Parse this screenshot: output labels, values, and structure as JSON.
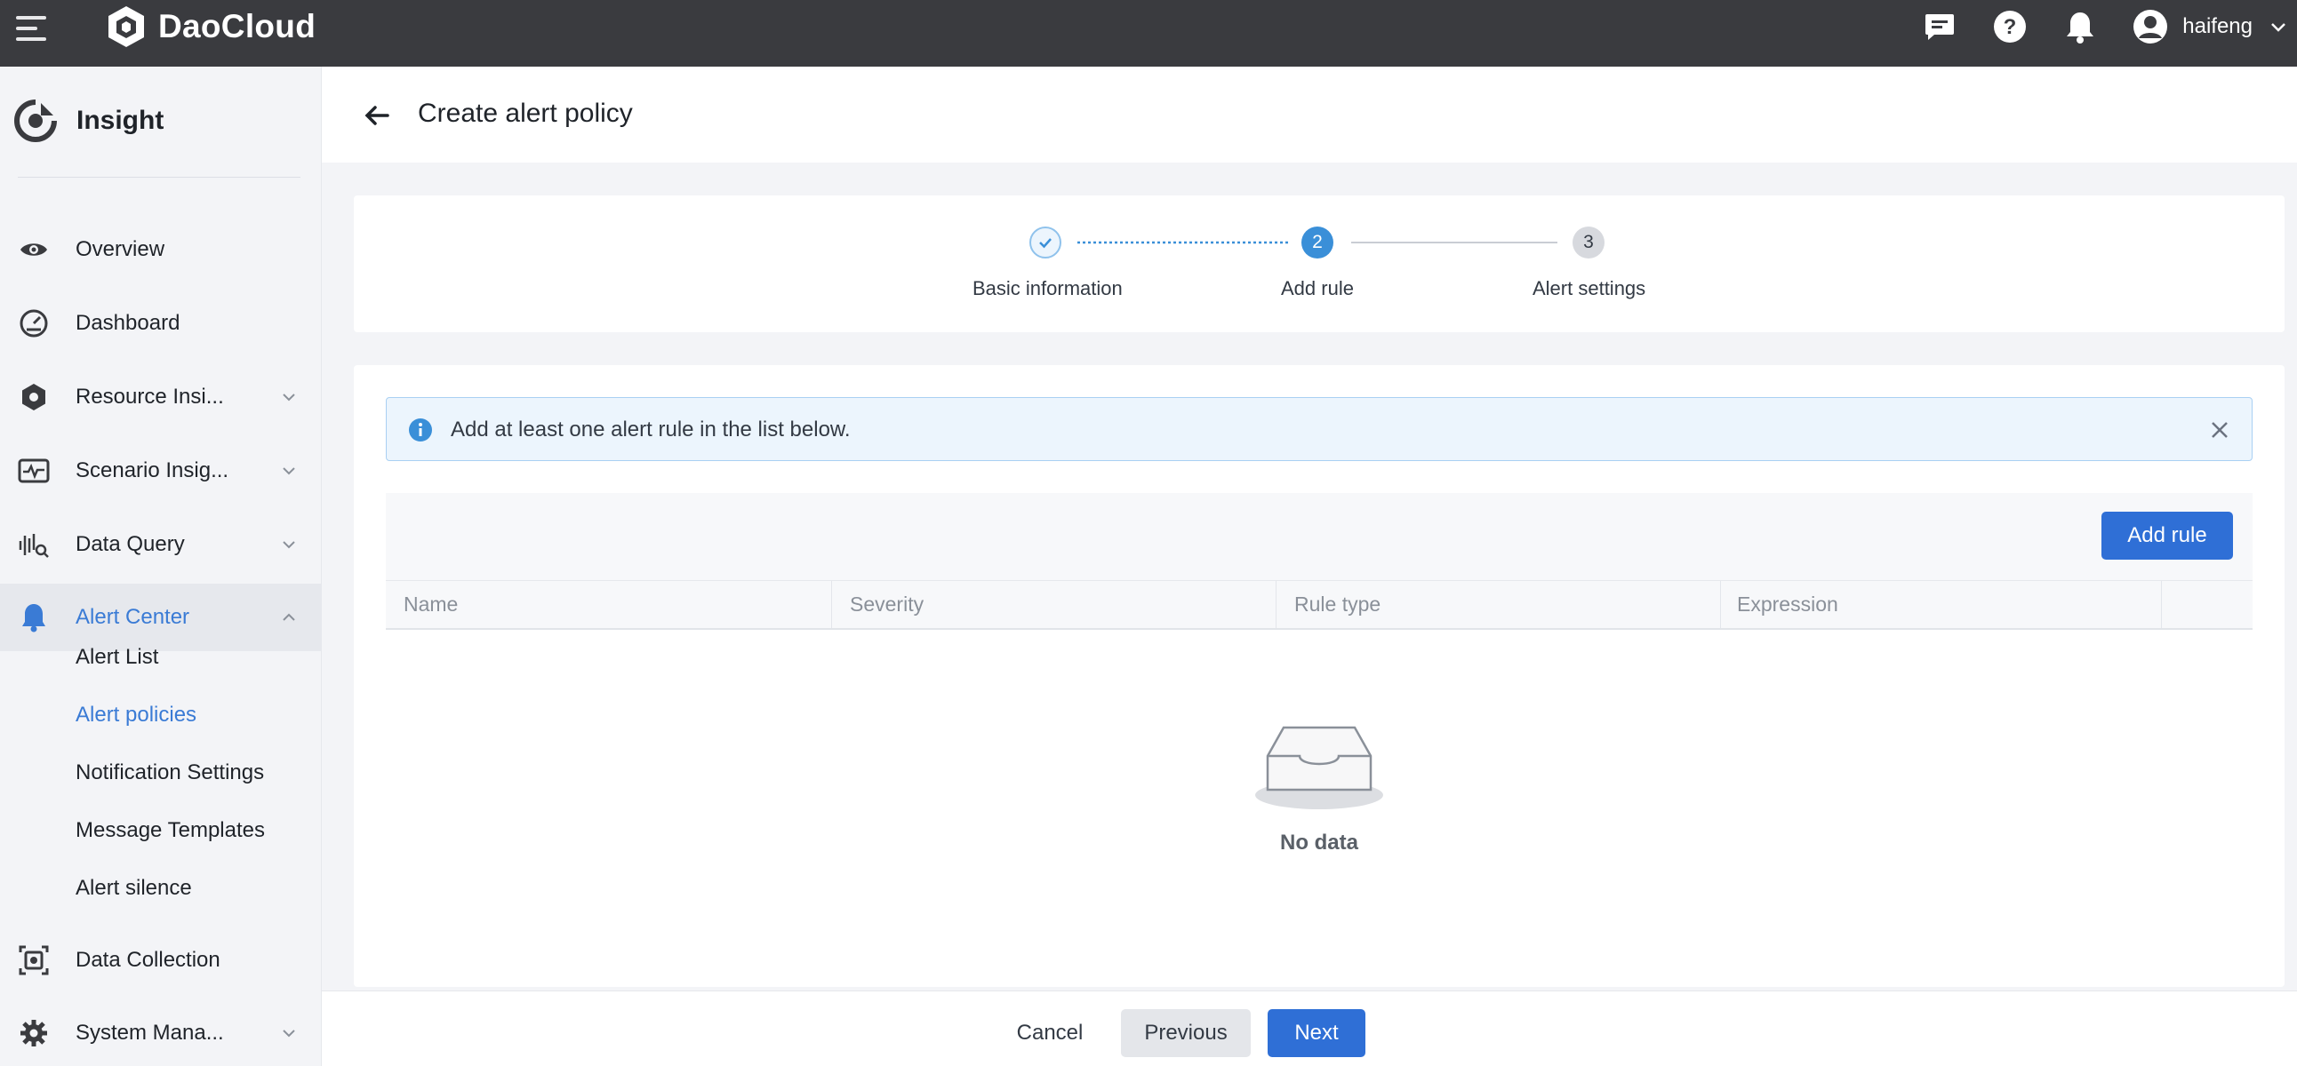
{
  "topbar": {
    "brand": "DaoCloud",
    "user_name": "haifeng",
    "icons": [
      "hamburger-menu-icon",
      "daocloud-logo-icon",
      "message-icon",
      "help-icon",
      "notification-bell-icon",
      "user-avatar-icon",
      "chevron-down-icon"
    ]
  },
  "sidebar": {
    "app_name": "Insight",
    "items": [
      {
        "label": "Overview",
        "icon": "eye-icon"
      },
      {
        "label": "Dashboard",
        "icon": "gauge-icon"
      },
      {
        "label": "Resource Insi...",
        "icon": "hexagon-icon"
      },
      {
        "label": "Scenario Insig...",
        "icon": "pulse-monitor-icon"
      },
      {
        "label": "Data Query",
        "icon": "waveform-search-icon"
      },
      {
        "label": "Alert Center",
        "icon": "bell-icon"
      },
      {
        "label": "Data Collection",
        "icon": "data-collection-icon"
      },
      {
        "label": "System Mana...",
        "icon": "gear-icon"
      }
    ],
    "alert_center_sub": [
      {
        "label": "Alert List"
      },
      {
        "label": "Alert policies"
      },
      {
        "label": "Notification Settings"
      },
      {
        "label": "Message Templates"
      },
      {
        "label": "Alert silence"
      }
    ],
    "accent_color": "#3a7bd5"
  },
  "page": {
    "title": "Create alert policy"
  },
  "steps": [
    {
      "label": "Basic information",
      "state": "done",
      "number": ""
    },
    {
      "label": "Add rule",
      "state": "active",
      "number": "2"
    },
    {
      "label": "Alert settings",
      "state": "pending",
      "number": "3"
    }
  ],
  "alert": {
    "message": "Add at least one alert rule in the list below."
  },
  "table": {
    "add_rule_label": "Add rule",
    "columns": [
      "Name",
      "Severity",
      "Rule type",
      "Expression",
      ""
    ],
    "empty_text": "No data"
  },
  "footer": {
    "cancel": "Cancel",
    "previous": "Previous",
    "next": "Next"
  },
  "colors": {
    "primary": "#2f6fd6",
    "topbar": "#3a3b3f",
    "info_bg": "#ecf5fd"
  }
}
